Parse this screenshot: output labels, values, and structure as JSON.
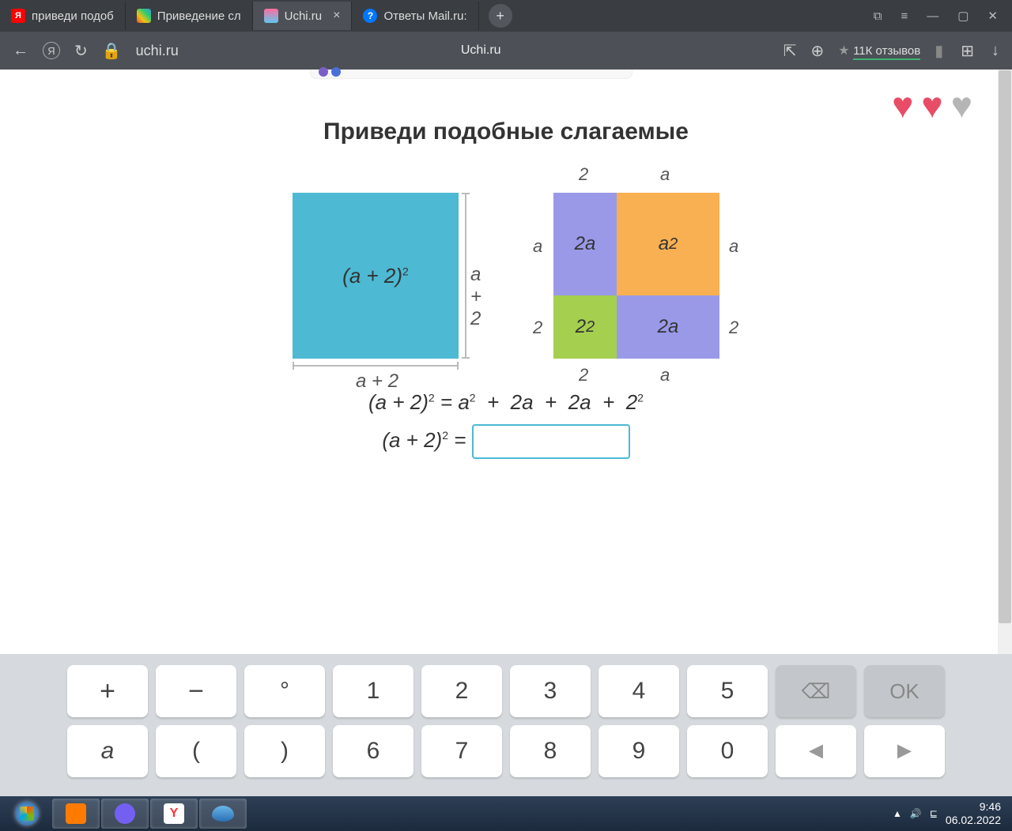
{
  "browser": {
    "tabs": [
      {
        "title": "приведи подоб",
        "icon_bg": "#ff0000",
        "icon_text": "Я"
      },
      {
        "title": "Приведение сл",
        "icon_bg": "#222"
      },
      {
        "title": "Uchi.ru",
        "icon_bg": "#ff6b9d",
        "active": true
      },
      {
        "title": "Ответы Mail.ru:",
        "icon_bg": "#0077ff",
        "icon_text": "?"
      }
    ],
    "new_tab": "+",
    "address": "uchi.ru",
    "page_title": "Uchi.ru",
    "reviews": "11К отзывов"
  },
  "task": {
    "title": "Приведи подобные слагаемые",
    "hearts": [
      "red",
      "red",
      "gray"
    ],
    "left_square": {
      "label": "(a + 2)",
      "side_r": "a + 2",
      "side_b": "a + 2"
    },
    "right_grid": {
      "top_left_dim": "2",
      "top_right_dim": "a",
      "left_top_dim": "a",
      "left_bottom_dim": "2",
      "right_top_dim": "a",
      "right_bottom_dim": "2",
      "bottom_left_dim": "2",
      "bottom_right_dim": "a",
      "cells": {
        "tl": "2a",
        "tr": "a",
        "bl": "2",
        "br": "2a"
      }
    },
    "eq1_lhs": "(a + 2)",
    "eq1_rhs": " =  a²  +  2a  +  2a  +  2²",
    "eq2_lhs": "(a + 2)",
    "eq2_eq": " = ",
    "answer_value": ""
  },
  "keyboard": {
    "row1": [
      "+",
      "−",
      "°",
      "1",
      "2",
      "3",
      "4",
      "5"
    ],
    "back": "⌫",
    "ok": "OK",
    "row2": [
      "a",
      "(",
      ")",
      "6",
      "7",
      "8",
      "9",
      "0",
      "◄",
      "►"
    ]
  },
  "system": {
    "time": "9:46",
    "date": "06.02.2022"
  }
}
